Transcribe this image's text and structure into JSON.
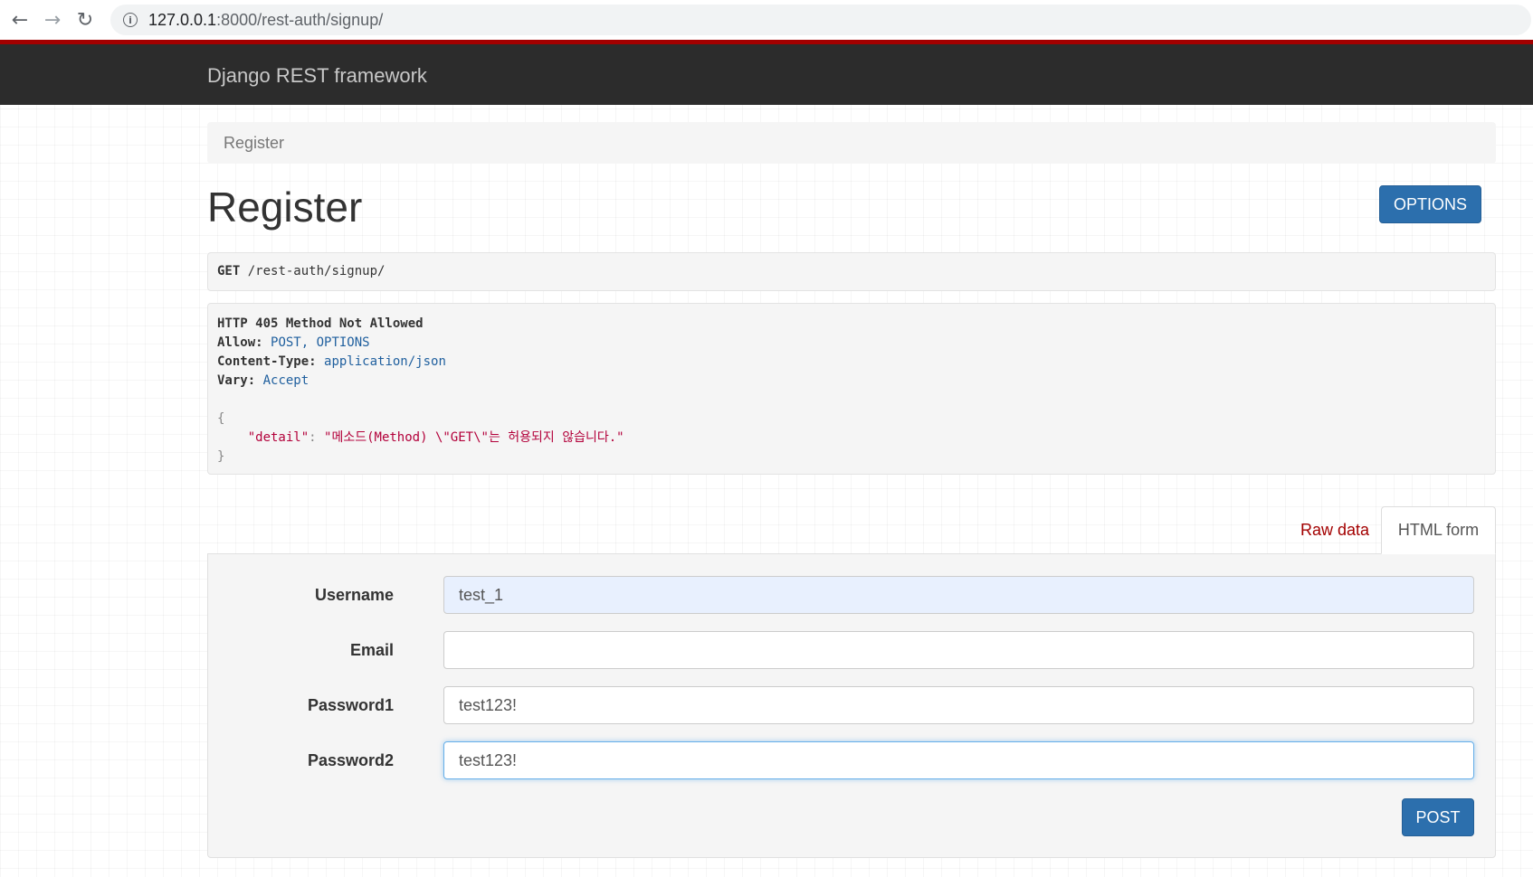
{
  "browser": {
    "url_host": "127.0.0.1",
    "url_path": ":8000/rest-auth/signup/",
    "back_icon": "←",
    "forward_icon": "→",
    "reload_icon": "↻",
    "info_icon": "i"
  },
  "navbar": {
    "brand": "Django REST framework",
    "accent_color": "#a30000",
    "background": "#2c2c2c"
  },
  "breadcrumb": "Register",
  "page_title": "Register",
  "options_button": "OPTIONS",
  "request": {
    "method": "GET",
    "path": "/rest-auth/signup/"
  },
  "response": {
    "status_line": "HTTP 405 Method Not Allowed",
    "headers": [
      {
        "key": "Allow:",
        "value": "POST, OPTIONS"
      },
      {
        "key": "Content-Type:",
        "value": "application/json"
      },
      {
        "key": "Vary:",
        "value": "Accept"
      }
    ],
    "body_open": "{",
    "detail_key": "\"detail\"",
    "detail_sep": ": ",
    "detail_value": "\"메소드(Method) \\\"GET\\\"는 허용되지 않습니다.\"",
    "body_close": "}"
  },
  "tabs": {
    "raw": "Raw data",
    "html": "HTML form"
  },
  "form": {
    "fields": [
      {
        "label": "Username",
        "value": "test_1",
        "placeholder": ""
      },
      {
        "label": "Email",
        "value": "",
        "placeholder": ""
      },
      {
        "label": "Password1",
        "value": "test123!",
        "placeholder": ""
      },
      {
        "label": "Password2",
        "value": "test123!",
        "placeholder": ""
      }
    ],
    "submit": "POST"
  },
  "colors": {
    "primary_button": "#2c6fad",
    "link_red": "#a30000",
    "header_value_blue": "#1f5f9e",
    "json_string": "#b3003a"
  }
}
